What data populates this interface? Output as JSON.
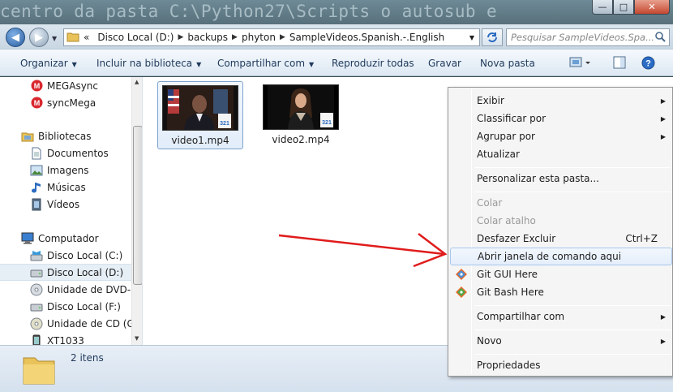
{
  "window": {
    "background_text": "centro da pasta C:\\Python27\\Scripts o autosub e"
  },
  "address": {
    "overflow": "«",
    "crumbs": [
      "Disco Local (D:)",
      "backups",
      "phyton",
      "SampleVideos.Spanish.-.English"
    ],
    "search_placeholder": "Pesquisar SampleVideos.Spa..."
  },
  "toolbar": {
    "organizar": "Organizar",
    "incluir": "Incluir na biblioteca",
    "compartilhar": "Compartilhar com",
    "reproduzir": "Reproduzir todas",
    "gravar": "Gravar",
    "nova_pasta": "Nova pasta"
  },
  "nav": {
    "items": [
      {
        "label": "MEGAsync",
        "icon": "mega-icon"
      },
      {
        "label": "syncMega",
        "icon": "mega-icon"
      },
      {
        "label": "Bibliotecas",
        "icon": "libraries-icon"
      },
      {
        "label": "Documentos",
        "icon": "documents-icon"
      },
      {
        "label": "Imagens",
        "icon": "pictures-icon"
      },
      {
        "label": "Músicas",
        "icon": "music-icon"
      },
      {
        "label": "Vídeos",
        "icon": "videos-icon"
      },
      {
        "label": "Computador",
        "icon": "computer-icon"
      },
      {
        "label": "Disco Local (C:)",
        "icon": "drive-c-icon"
      },
      {
        "label": "Disco Local (D:)",
        "icon": "drive-icon"
      },
      {
        "label": "Unidade de DVD-RW",
        "icon": "dvd-icon"
      },
      {
        "label": "Disco Local  (F:)",
        "icon": "drive-icon"
      },
      {
        "label": "Unidade de CD (G:)",
        "icon": "cd-icon"
      },
      {
        "label": "XT1033",
        "icon": "phone-icon"
      }
    ]
  },
  "files": [
    {
      "name": "video1.mp4"
    },
    {
      "name": "video2.mp4"
    }
  ],
  "status": {
    "count": "2 itens"
  },
  "context_menu": {
    "exibir": "Exibir",
    "classificar": "Classificar por",
    "agrupar": "Agrupar por",
    "atualizar": "Atualizar",
    "personalizar": "Personalizar esta pasta...",
    "colar": "Colar",
    "colar_atalho": "Colar atalho",
    "desfazer": "Desfazer Excluir",
    "desfazer_shortcut": "Ctrl+Z",
    "abrir_cmd": "Abrir janela de comando aqui",
    "git_gui": "Git GUI Here",
    "git_bash": "Git Bash Here",
    "compartilhar": "Compartilhar com",
    "novo": "Novo",
    "propriedades": "Propriedades"
  },
  "colors": {
    "annotation_arrow": "#e01b1b",
    "menu_highlight": "#e4eefb"
  }
}
